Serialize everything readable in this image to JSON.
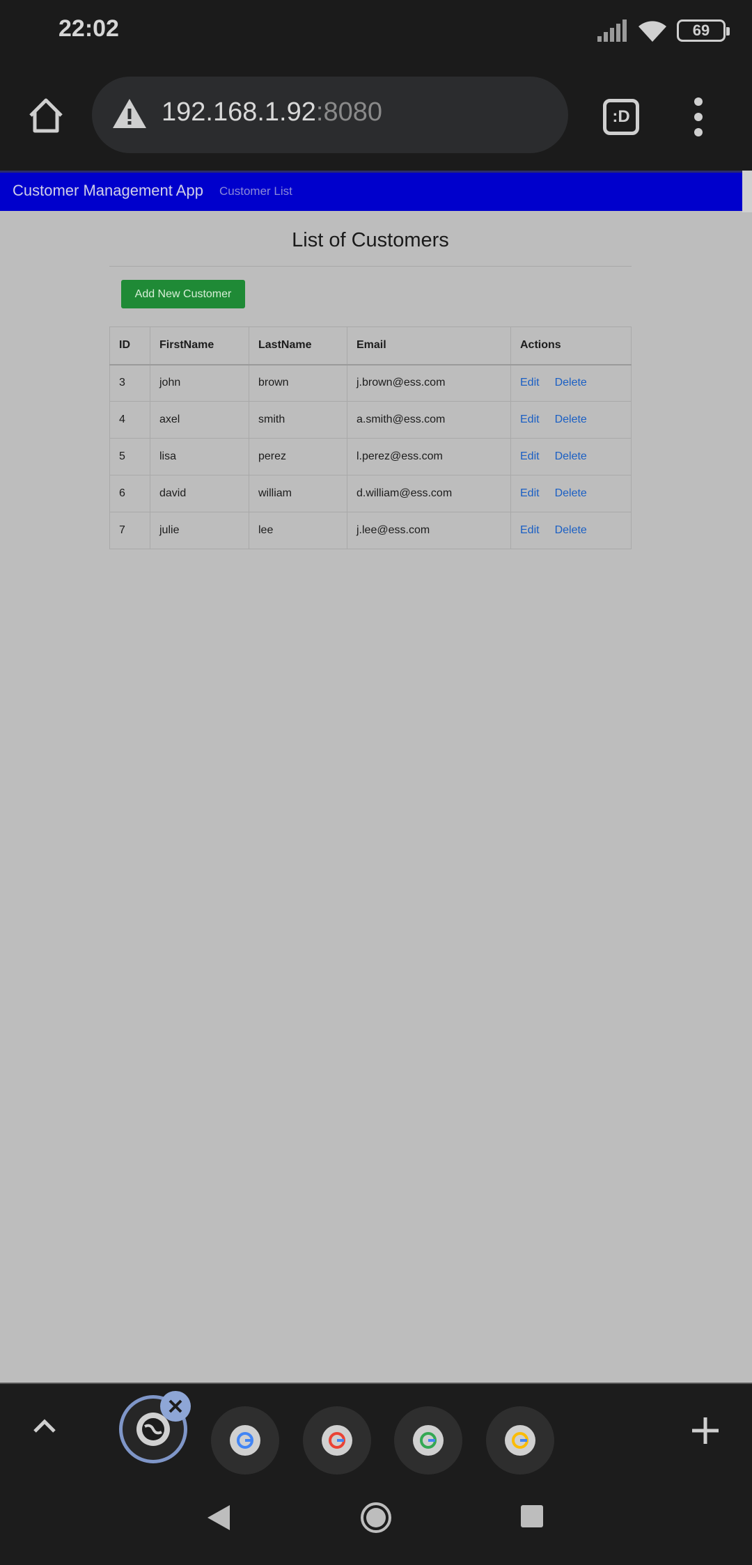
{
  "status_bar": {
    "time": "22:02",
    "battery": "69"
  },
  "browser": {
    "url_host": "192.168.1.92",
    "url_port": ":8080",
    "extension_label": ":D"
  },
  "navbar": {
    "brand": "Customer Management App",
    "link": "Customer List"
  },
  "page": {
    "title": "List of Customers",
    "add_button": "Add New Customer",
    "table": {
      "headers": [
        "ID",
        "FirstName",
        "LastName",
        "Email",
        "Actions"
      ],
      "rows": [
        {
          "id": "3",
          "first": "john",
          "last": "brown",
          "email": "j.brown@ess.com"
        },
        {
          "id": "4",
          "first": "axel",
          "last": "smith",
          "email": "a.smith@ess.com"
        },
        {
          "id": "5",
          "first": "lisa",
          "last": "perez",
          "email": "l.perez@ess.com"
        },
        {
          "id": "6",
          "first": "david",
          "last": "william",
          "email": "d.william@ess.com"
        },
        {
          "id": "7",
          "first": "julie",
          "last": "lee",
          "email": "j.lee@ess.com"
        }
      ],
      "edit_label": "Edit",
      "delete_label": "Delete"
    }
  },
  "colors": {
    "navbar": "#0000cc",
    "add_button": "#1f8a36",
    "action_link": "#1a5fc4",
    "chrome": "#1b1b1b"
  }
}
